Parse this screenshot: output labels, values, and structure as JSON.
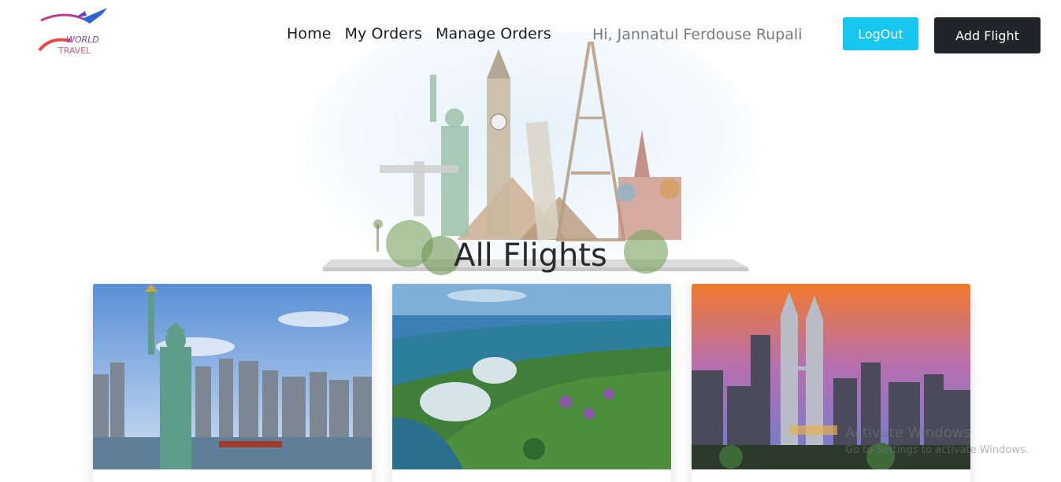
{
  "header": {
    "nav": [
      {
        "label": "Home"
      },
      {
        "label": "My Orders"
      },
      {
        "label": "Manage Orders"
      }
    ],
    "greeting": "Hi, Jannatul Ferdouse Rupali",
    "logout_label": "LogOut",
    "add_flight_label": "Add Flight",
    "logo_text": "WORLD TRAVEL"
  },
  "main": {
    "title": "All Flights",
    "cards": [
      {
        "image": "new-york-statue-of-liberty"
      },
      {
        "image": "singapore-gardens-by-the-bay"
      },
      {
        "image": "kuala-lumpur-petronas-towers"
      }
    ]
  },
  "watermark": {
    "title": "Activate Windows",
    "subtitle": "Go to Settings to activate Windows."
  },
  "colors": {
    "accent": "#17c6ee",
    "dark": "#212529"
  }
}
